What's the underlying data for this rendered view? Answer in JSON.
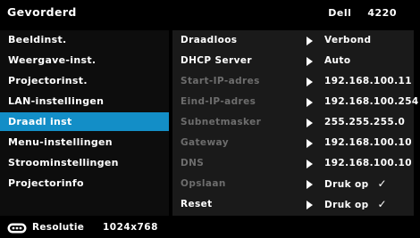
{
  "header": {
    "title": "Gevorderd",
    "brand": "Dell",
    "model": "4220"
  },
  "sidebar": {
    "items": [
      {
        "label": "Beeldinst."
      },
      {
        "label": "Weergave-inst."
      },
      {
        "label": "Projectorinst."
      },
      {
        "label": "LAN-instellingen"
      },
      {
        "label": "Draadl inst",
        "active": true
      },
      {
        "label": "Menu-instellingen"
      },
      {
        "label": "Stroominstellingen"
      },
      {
        "label": "Projectorinfo"
      }
    ]
  },
  "settings": {
    "rows": [
      {
        "label": "Draadloos",
        "value": "Verbond",
        "enabled": true
      },
      {
        "label": "DHCP Server",
        "value": "Auto",
        "enabled": true
      },
      {
        "label": "Start-IP-adres",
        "value": "192.168.100.11",
        "enabled": false
      },
      {
        "label": "Eind-IP-adres",
        "value": "192.168.100.254",
        "enabled": false
      },
      {
        "label": "Subnetmasker",
        "value": "255.255.255.0",
        "enabled": false
      },
      {
        "label": "Gateway",
        "value": "192.168.100.10",
        "enabled": false
      },
      {
        "label": "DNS",
        "value": "192.168.100.10",
        "enabled": false
      },
      {
        "label": "Opslaan",
        "value": "Druk op",
        "check": "✓",
        "enabled": false
      },
      {
        "label": "Reset",
        "value": "Druk op",
        "check": "✓",
        "enabled": true
      }
    ]
  },
  "footer": {
    "icon": "controller-icon",
    "label": "Resolutie",
    "resolution": "1024x768"
  },
  "colors": {
    "active": "#138ec7",
    "disabled_text": "#6d6d6d",
    "panel": "#1a1a1a"
  }
}
